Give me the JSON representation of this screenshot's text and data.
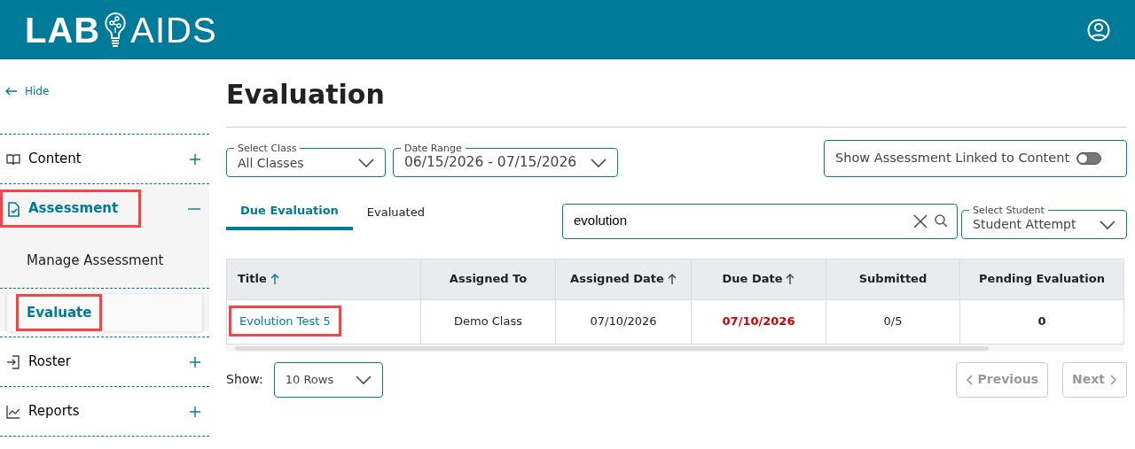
{
  "header": {
    "logo_left": "LAB",
    "logo_right": "AIDS"
  },
  "sidebar": {
    "hide_label": "Hide",
    "items": [
      {
        "label": "Content",
        "expanded": false,
        "selected": false,
        "highlighted": false
      },
      {
        "label": "Assessment",
        "expanded": true,
        "selected": true,
        "highlighted": true,
        "children": [
          {
            "label": "Manage Assessment",
            "selected": false,
            "highlighted": false
          },
          {
            "label": "Evaluate",
            "selected": true,
            "highlighted": true
          }
        ]
      },
      {
        "label": "Roster",
        "expanded": false,
        "selected": false,
        "highlighted": false
      },
      {
        "label": "Reports",
        "expanded": false,
        "selected": false,
        "highlighted": false
      }
    ]
  },
  "page_title": "Evaluation",
  "filters": {
    "class_select": {
      "label": "Select Class",
      "value": "All Classes"
    },
    "date_range": {
      "label": "Date Range",
      "value": "06/15/2026 - 07/15/2026"
    },
    "linked_toggle": {
      "label": "Show Assessment Linked to Content",
      "on": false
    }
  },
  "tabs": [
    {
      "label": "Due Evaluation",
      "selected": true
    },
    {
      "label": "Evaluated",
      "selected": false
    }
  ],
  "search": {
    "value": "evolution"
  },
  "student_select": {
    "label": "Select Student",
    "value": "Student Attempt"
  },
  "table": {
    "columns": [
      {
        "label": "Title",
        "sortable": true,
        "active": true
      },
      {
        "label": "Assigned To",
        "sortable": false
      },
      {
        "label": "Assigned Date",
        "sortable": true,
        "active": false
      },
      {
        "label": "Due Date",
        "sortable": true,
        "active": false
      },
      {
        "label": "Submitted",
        "sortable": false
      },
      {
        "label": "Pending Evaluation",
        "sortable": false
      }
    ],
    "rows": [
      {
        "title": "Evolution Test 5",
        "highlighted": true,
        "assigned_to": "Demo Class",
        "assigned_date": "07/10/2026",
        "due_date": "07/10/2026",
        "overdue": true,
        "submitted": "0/5",
        "pending": "0"
      }
    ]
  },
  "pagination": {
    "show_label": "Show:",
    "rows_value": "10 Rows",
    "previous": "Previous",
    "next": "Next",
    "previous_disabled": true,
    "next_disabled": true
  }
}
